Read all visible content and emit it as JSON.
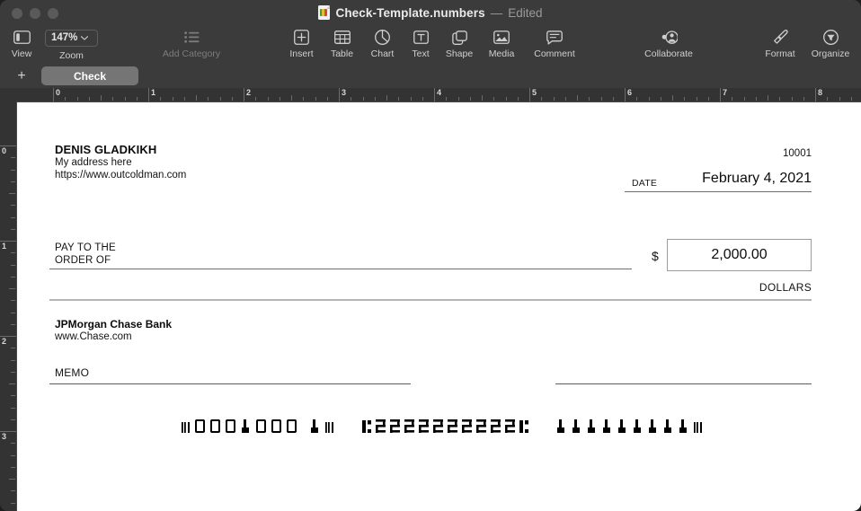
{
  "window": {
    "title": "Check-Template.numbers",
    "separator": "—",
    "edit_state": "Edited",
    "traffic_lights": [
      "close",
      "minimize",
      "zoom"
    ]
  },
  "toolbar": {
    "items": [
      {
        "label": "View",
        "icon": "sidebar-icon",
        "enabled": true
      },
      {
        "label": "Zoom",
        "icon": "zoom-stepper",
        "enabled": true
      },
      {
        "label": "Add Category",
        "icon": "list-icon",
        "enabled": false
      },
      {
        "label": "Insert",
        "icon": "insert-function-icon",
        "enabled": true
      },
      {
        "label": "Table",
        "icon": "table-icon",
        "enabled": true
      },
      {
        "label": "Chart",
        "icon": "chart-pie-icon",
        "enabled": true
      },
      {
        "label": "Text",
        "icon": "text-box-icon",
        "enabled": true
      },
      {
        "label": "Shape",
        "icon": "shape-icon",
        "enabled": true
      },
      {
        "label": "Media",
        "icon": "media-image-icon",
        "enabled": true
      },
      {
        "label": "Comment",
        "icon": "comment-icon",
        "enabled": true
      },
      {
        "label": "Collaborate",
        "icon": "collaborate-icon",
        "enabled": true
      },
      {
        "label": "Format",
        "icon": "format-brush-icon",
        "enabled": true
      },
      {
        "label": "Organize",
        "icon": "organize-icon",
        "enabled": true
      }
    ],
    "zoom_value": "147%",
    "zoom_chevron": "⌄"
  },
  "sheet_bar": {
    "add_label": "+",
    "tabs": [
      {
        "label": "Check",
        "active": true
      }
    ]
  },
  "rulers": {
    "unit": "in",
    "horizontal_ticks": [
      "0",
      "1",
      "2",
      "3",
      "4",
      "5",
      "6",
      "7",
      "8"
    ],
    "vertical_ticks": [
      "0",
      "1",
      "2",
      "3"
    ]
  },
  "check": {
    "payer_name": "DENIS GLADKIKH",
    "payer_address": "My address here",
    "payer_website": "https://www.outcoldman.com",
    "check_number": "10001",
    "date_label": "DATE",
    "date_value": "February 4, 2021",
    "pay_to_line1": "PAY TO THE",
    "pay_to_line2": "ORDER OF",
    "payee_value": "",
    "currency_symbol": "$",
    "amount_value": "2,000.00",
    "dollars_label": "DOLLARS",
    "bank_name": "JPMorgan Chase Bank",
    "bank_website": "www.Chase.com",
    "memo_label": "MEMO",
    "memo_value": "",
    "signature_value": "",
    "micr": {
      "routing_group": "⌈0001000 1⌈",
      "account_group": "⌆2222222222⌆",
      "check_group": "111111111⌈",
      "raw": "⌈0001000 1⌈  ⌆2222222222⌆  111111111⌈"
    }
  },
  "colors": {
    "window_chrome": "#3b3b3b",
    "ruler": "#333333",
    "canvas": "#ffffff",
    "tab_active": "#757575",
    "toolbar_label": "#cfcfcf",
    "toolbar_label_disabled": "#7c7c7c",
    "rule_line": "#b5b5b5"
  }
}
